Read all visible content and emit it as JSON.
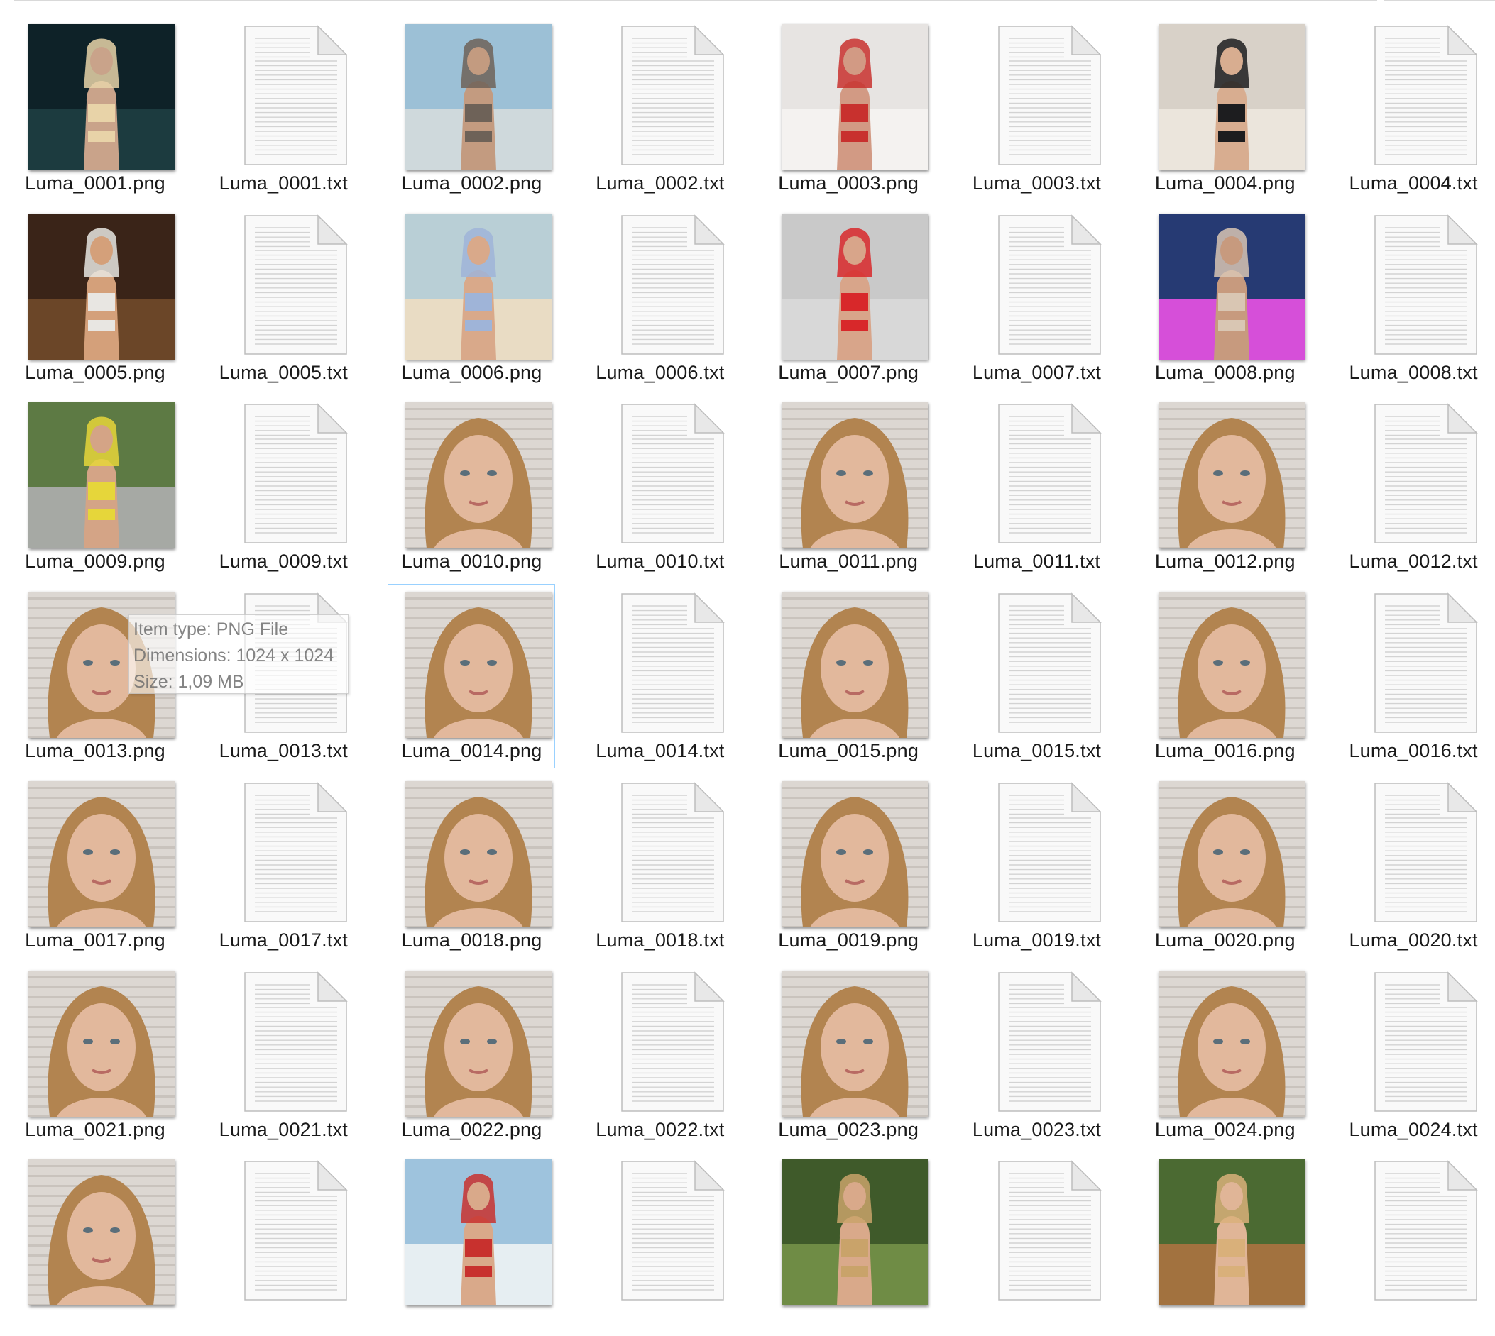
{
  "files": [
    {
      "name": "Luma_0001.png",
      "kind": "image",
      "scene": "night-pool",
      "palette": [
        "#0e2228",
        "#1c3b3f",
        "#c9a38a",
        "#e8d3a8"
      ]
    },
    {
      "name": "Luma_0001.txt",
      "kind": "text"
    },
    {
      "name": "Luma_0002.png",
      "kind": "image",
      "scene": "boat-selfie",
      "palette": [
        "#9cc0d6",
        "#cfd9dc",
        "#c39b80",
        "#6e6258"
      ]
    },
    {
      "name": "Luma_0002.txt",
      "kind": "text"
    },
    {
      "name": "Luma_0003.png",
      "kind": "image",
      "scene": "bed-red",
      "palette": [
        "#e7e4e2",
        "#f4f2f0",
        "#d29a84",
        "#c8312e"
      ]
    },
    {
      "name": "Luma_0003.txt",
      "kind": "text"
    },
    {
      "name": "Luma_0004.png",
      "kind": "image",
      "scene": "room-black-suit",
      "palette": [
        "#d8d1c8",
        "#ebe5dc",
        "#d8ad90",
        "#1d1d1f"
      ]
    },
    {
      "name": "Luma_0004.txt",
      "kind": "text"
    },
    {
      "name": "Luma_0005.png",
      "kind": "image",
      "scene": "lamp-room",
      "palette": [
        "#3a2418",
        "#6b4628",
        "#d4a07a",
        "#e8e6e2"
      ]
    },
    {
      "name": "Luma_0005.txt",
      "kind": "text"
    },
    {
      "name": "Luma_0006.png",
      "kind": "image",
      "scene": "beach-kneel",
      "palette": [
        "#b9cfd6",
        "#e9dcc4",
        "#d9a98a",
        "#9fb4d8"
      ]
    },
    {
      "name": "Luma_0006.txt",
      "kind": "text"
    },
    {
      "name": "Luma_0007.png",
      "kind": "image",
      "scene": "studio-red",
      "palette": [
        "#c9c9c9",
        "#d8d8d8",
        "#d8a58a",
        "#d8282a"
      ]
    },
    {
      "name": "Luma_0007.txt",
      "kind": "text"
    },
    {
      "name": "Luma_0008.png",
      "kind": "image",
      "scene": "neon-lounge",
      "palette": [
        "#263a73",
        "#d64fd9",
        "#c79a7e",
        "#d9c6b3"
      ]
    },
    {
      "name": "Luma_0008.txt",
      "kind": "text"
    },
    {
      "name": "Luma_0009.png",
      "kind": "image",
      "scene": "park-yellow",
      "palette": [
        "#5d7a44",
        "#a6a9a4",
        "#d4a486",
        "#e6d63a"
      ]
    },
    {
      "name": "Luma_0009.txt",
      "kind": "text"
    },
    {
      "name": "Luma_0010.png",
      "kind": "image",
      "scene": "portrait",
      "palette": [
        "#c9c3bd",
        "#dcd7d2",
        "#e2b89c",
        "#b28450"
      ]
    },
    {
      "name": "Luma_0010.txt",
      "kind": "text"
    },
    {
      "name": "Luma_0011.png",
      "kind": "image",
      "scene": "portrait",
      "palette": [
        "#c9c3bd",
        "#dcd7d2",
        "#e2b89c",
        "#b28450"
      ]
    },
    {
      "name": "Luma_0011.txt",
      "kind": "text"
    },
    {
      "name": "Luma_0012.png",
      "kind": "image",
      "scene": "portrait",
      "palette": [
        "#c9c3bd",
        "#dcd7d2",
        "#e2b89c",
        "#b28450"
      ]
    },
    {
      "name": "Luma_0012.txt",
      "kind": "text"
    },
    {
      "name": "Luma_0013.png",
      "kind": "image",
      "scene": "portrait",
      "palette": [
        "#c9c3bd",
        "#dcd7d2",
        "#e2b89c",
        "#b28450"
      ]
    },
    {
      "name": "Luma_0013.txt",
      "kind": "text"
    },
    {
      "name": "Luma_0014.png",
      "kind": "image",
      "scene": "portrait",
      "palette": [
        "#c9c3bd",
        "#dcd7d2",
        "#e2b89c",
        "#b28450"
      ]
    },
    {
      "name": "Luma_0014.txt",
      "kind": "text"
    },
    {
      "name": "Luma_0015.png",
      "kind": "image",
      "scene": "portrait",
      "palette": [
        "#c9c3bd",
        "#dcd7d2",
        "#e2b89c",
        "#b28450"
      ]
    },
    {
      "name": "Luma_0015.txt",
      "kind": "text"
    },
    {
      "name": "Luma_0016.png",
      "kind": "image",
      "scene": "portrait",
      "palette": [
        "#c9c3bd",
        "#dcd7d2",
        "#e2b89c",
        "#b28450"
      ]
    },
    {
      "name": "Luma_0016.txt",
      "kind": "text"
    },
    {
      "name": "Luma_0017.png",
      "kind": "image",
      "scene": "portrait",
      "palette": [
        "#c9c3bd",
        "#dcd7d2",
        "#e2b89c",
        "#b28450"
      ]
    },
    {
      "name": "Luma_0017.txt",
      "kind": "text"
    },
    {
      "name": "Luma_0018.png",
      "kind": "image",
      "scene": "portrait",
      "palette": [
        "#c9c3bd",
        "#dcd7d2",
        "#e2b89c",
        "#b28450"
      ]
    },
    {
      "name": "Luma_0018.txt",
      "kind": "text"
    },
    {
      "name": "Luma_0019.png",
      "kind": "image",
      "scene": "portrait",
      "palette": [
        "#c9c3bd",
        "#dcd7d2",
        "#e2b89c",
        "#b28450"
      ]
    },
    {
      "name": "Luma_0019.txt",
      "kind": "text"
    },
    {
      "name": "Luma_0020.png",
      "kind": "image",
      "scene": "portrait",
      "palette": [
        "#c9c3bd",
        "#dcd7d2",
        "#e2b89c",
        "#b28450"
      ]
    },
    {
      "name": "Luma_0020.txt",
      "kind": "text"
    },
    {
      "name": "Luma_0021.png",
      "kind": "image",
      "scene": "portrait",
      "palette": [
        "#c9c3bd",
        "#dcd7d2",
        "#e2b89c",
        "#b28450"
      ]
    },
    {
      "name": "Luma_0021.txt",
      "kind": "text"
    },
    {
      "name": "Luma_0022.png",
      "kind": "image",
      "scene": "portrait",
      "palette": [
        "#c9c3bd",
        "#dcd7d2",
        "#e2b89c",
        "#b28450"
      ]
    },
    {
      "name": "Luma_0022.txt",
      "kind": "text"
    },
    {
      "name": "Luma_0023.png",
      "kind": "image",
      "scene": "portrait",
      "palette": [
        "#c9c3bd",
        "#dcd7d2",
        "#e2b89c",
        "#b28450"
      ]
    },
    {
      "name": "Luma_0023.txt",
      "kind": "text"
    },
    {
      "name": "Luma_0024.png",
      "kind": "image",
      "scene": "portrait",
      "palette": [
        "#c9c3bd",
        "#dcd7d2",
        "#e2b89c",
        "#b28450"
      ]
    },
    {
      "name": "Luma_0024.txt",
      "kind": "text"
    },
    {
      "name": "",
      "kind": "image",
      "scene": "portrait",
      "palette": [
        "#c9c3bd",
        "#dcd7d2",
        "#e2b89c",
        "#b28450"
      ]
    },
    {
      "name": "",
      "kind": "text"
    },
    {
      "name": "",
      "kind": "image",
      "scene": "beach-red",
      "palette": [
        "#9ec3dd",
        "#e6eef2",
        "#d9a98a",
        "#c8312e"
      ]
    },
    {
      "name": "",
      "kind": "text"
    },
    {
      "name": "",
      "kind": "image",
      "scene": "forest",
      "palette": [
        "#3f5a2a",
        "#6f8c45",
        "#d9a98a",
        "#c9a36a"
      ]
    },
    {
      "name": "",
      "kind": "text"
    },
    {
      "name": "",
      "kind": "image",
      "scene": "garden",
      "palette": [
        "#4b6a32",
        "#a2723f",
        "#e0b597",
        "#d9b07a"
      ]
    },
    {
      "name": "",
      "kind": "text"
    }
  ],
  "selected": "Luma_0014.png",
  "tooltip": {
    "item_type": "Item type: PNG File",
    "dimensions": "Dimensions: 1024 x 1024",
    "size": "Size: 1,09 MB"
  }
}
